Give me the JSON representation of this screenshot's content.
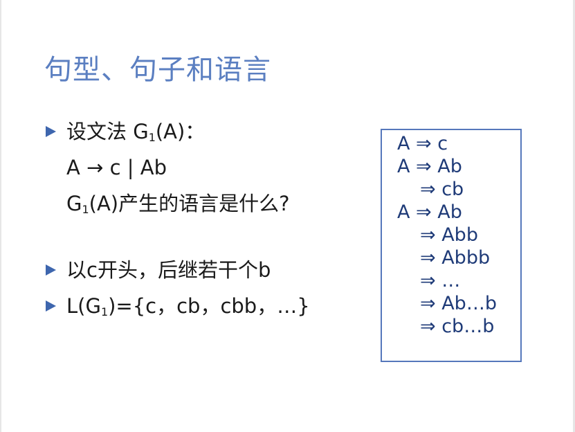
{
  "title": "句型、句子和语言",
  "bullets": {
    "b1": {
      "prefix": "设文法 G",
      "sub": "1",
      "suffix": "(A)："
    },
    "rule": "A → c | Ab",
    "q": {
      "prefix": "G",
      "sub": "1",
      "suffix": "(A)产生的语言是什么?"
    },
    "b2": "以c开头，后继若干个b",
    "b3": {
      "prefix": "L(G",
      "sub": "1",
      "suffix": ")={c，cb，cbb，…}"
    }
  },
  "derivations": [
    "A ⇒ c",
    "A ⇒ Ab",
    "⇒ cb",
    "A ⇒ Ab",
    "⇒ Abb",
    "⇒ Abbb",
    "⇒ …",
    "⇒ Ab…b",
    "⇒ cb…b"
  ],
  "colors": {
    "title": "#5b7fc1",
    "bullet": "#3e66ae",
    "box_border": "#5577bb",
    "box_text": "#1f3b78"
  }
}
